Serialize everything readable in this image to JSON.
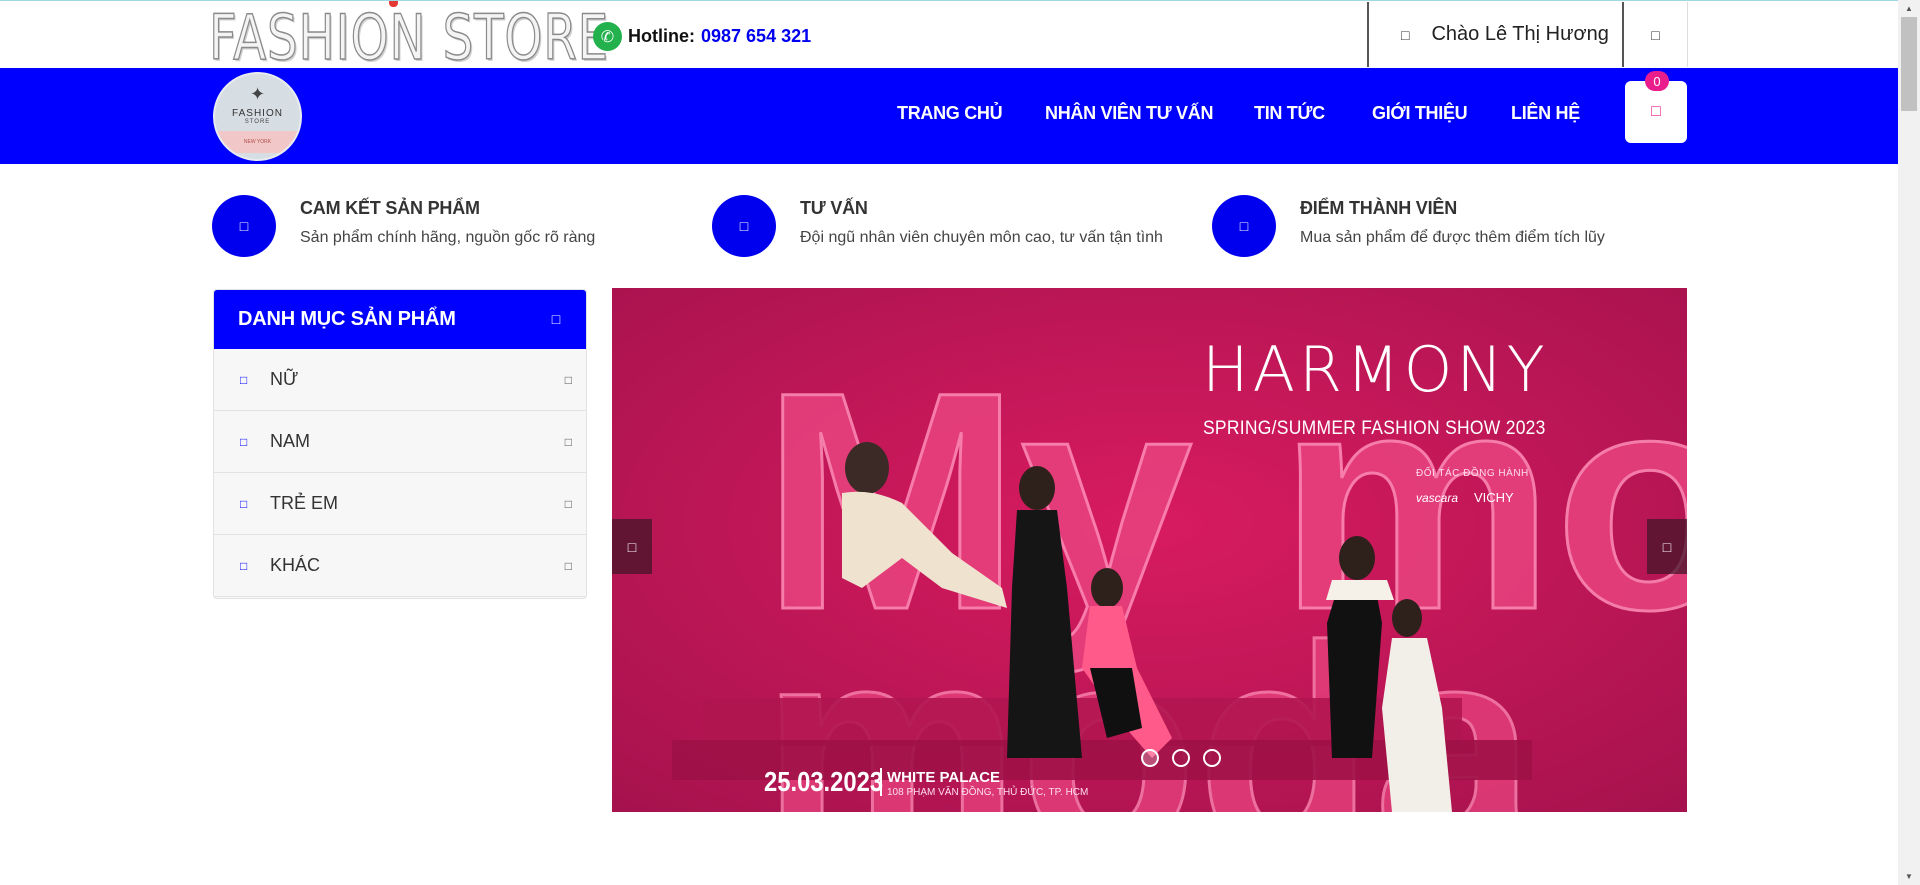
{
  "topbar": {
    "logo_text": "FASHION STORE",
    "hotline_label": "Hotline:",
    "hotline_number": "0987 654 321",
    "greeting": "Chào Lê Thị Hương",
    "user_icon": "user-icon",
    "logout_icon": "logout-icon"
  },
  "nav": {
    "logo": {
      "line1": "FASHION",
      "line2": "STORE",
      "line3": "NEW YORK"
    },
    "items": [
      "TRANG CHỦ",
      "NHÂN VIÊN TƯ VẤN",
      "TIN TỨC",
      "GIỚI THIỆU",
      "LIÊN HỆ"
    ],
    "cart_count": "0",
    "cart_icon": "shopping-bag-icon",
    "color": "#0000ff"
  },
  "features": [
    {
      "title": "CAM KẾT SẢN PHẨM",
      "desc": "Sản phẩm chính hãng, nguồn gốc rõ ràng",
      "icon": "check-icon"
    },
    {
      "title": "TƯ VẤN",
      "desc": "Đội ngũ nhân viên chuyên môn cao, tư vấn tận tình",
      "icon": "headset-icon"
    },
    {
      "title": "ĐIỂM THÀNH VIÊN",
      "desc": "Mua sản phẩm để được thêm điểm tích lũy",
      "icon": "star-icon"
    }
  ],
  "categories": {
    "title": "DANH MỤC SẢN PHẨM",
    "items": [
      "NỮ",
      "NAM",
      "TRẺ EM",
      "KHÁC"
    ]
  },
  "banner": {
    "brand": "HARMONY",
    "subtitle": "SPRING/SUMMER FASHION SHOW 2023",
    "partner_label": "ĐỐI TÁC ĐỒNG HÀNH",
    "partner1": "vascara",
    "partner2": "VICHY",
    "date": "25.03.2023",
    "venue": "WHITE PALACE",
    "address": "108 PHẠM VĂN ĐỒNG, THỦ ĐỨC, TP. HCM",
    "background_text": "My moda",
    "active_slide": 1,
    "slide_count": 3
  }
}
